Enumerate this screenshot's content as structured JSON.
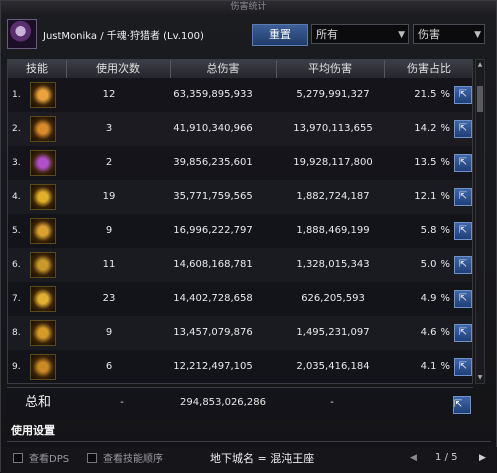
{
  "window": {
    "title": "伤害统计"
  },
  "header": {
    "player_name": "JustMonika",
    "separator": "/",
    "class_name": "千魂·狩猎者",
    "level": "(Lv.100)",
    "reset_label": "重置",
    "filter_select": "所有",
    "metric_select": "伤害"
  },
  "table": {
    "columns": [
      "技能",
      "使用次数",
      "总伤害",
      "平均伤害",
      "伤害占比"
    ],
    "rows": [
      {
        "rank": "1.",
        "uses": "12",
        "total": "63,359,895,933",
        "avg": "5,279,991,327",
        "pct": "21.5",
        "icon": "skill-icon-swirl",
        "color": "#e8a43a"
      },
      {
        "rank": "2.",
        "uses": "3",
        "total": "41,910,340,966",
        "avg": "13,970,113,655",
        "pct": "14.2",
        "icon": "skill-icon-burst",
        "color": "#d98b2b"
      },
      {
        "rank": "3.",
        "uses": "2",
        "total": "39,856,235,601",
        "avg": "19,928,117,800",
        "pct": "13.5",
        "icon": "skill-icon-slash",
        "color": "#b04fc9"
      },
      {
        "rank": "4.",
        "uses": "19",
        "total": "35,771,759,565",
        "avg": "1,882,724,187",
        "pct": "12.1",
        "icon": "skill-icon-wave",
        "color": "#e0b02a"
      },
      {
        "rank": "5.",
        "uses": "9",
        "total": "16,996,222,797",
        "avg": "1,888,469,199",
        "pct": "5.8",
        "icon": "skill-icon-blades",
        "color": "#d9a030"
      },
      {
        "rank": "6.",
        "uses": "11",
        "total": "14,608,168,781",
        "avg": "1,328,015,343",
        "pct": "5.0",
        "icon": "skill-icon-totem",
        "color": "#c99a2a"
      },
      {
        "rank": "7.",
        "uses": "23",
        "total": "14,402,728,658",
        "avg": "626,205,593",
        "pct": "4.9",
        "icon": "skill-icon-arc",
        "color": "#e2b030"
      },
      {
        "rank": "8.",
        "uses": "9",
        "total": "13,457,079,876",
        "avg": "1,495,231,097",
        "pct": "4.6",
        "icon": "skill-icon-wings",
        "color": "#d69a28"
      },
      {
        "rank": "9.",
        "uses": "6",
        "total": "12,212,497,105",
        "avg": "2,035,416,184",
        "pct": "4.1",
        "icon": "skill-icon-flame",
        "color": "#c98a24"
      }
    ],
    "percent_sign": "%",
    "share_glyph": "⇱"
  },
  "summary": {
    "label": "总和",
    "uses": "-",
    "total": "294,853,026,286",
    "avg": "-"
  },
  "settings": {
    "title": "使用设置",
    "view_dps": "查看DPS",
    "view_order": "查看技能顺序",
    "dungeon": "地下城名 = 混沌王座"
  },
  "pagination": {
    "current": "1",
    "sep": "/",
    "total": "5"
  },
  "colors": {
    "accent": "#2f5a9e",
    "header_bg": "#34363d"
  }
}
